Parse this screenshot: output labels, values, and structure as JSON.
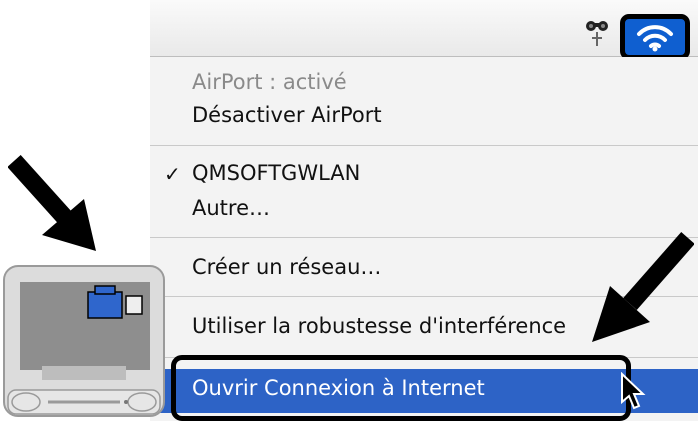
{
  "menubar": {
    "icons": [
      "binoculars-icon",
      "airport-wifi-icon"
    ]
  },
  "menu": {
    "status": "AirPort : activé",
    "turn_off": "Désactiver AirPort",
    "network_checked": "QMSOFTGWLAN",
    "other": "Autre…",
    "create_network": "Créer un réseau…",
    "interference": "Utiliser la robustesse d'interférence",
    "open_internet_connect": "Ouvrir Connexion à Internet",
    "checkmark": "✓"
  },
  "colors": {
    "highlight": "#2d63c6",
    "wifi_bg": "#0f5fd0",
    "menu_bg": "#f3f3f3"
  }
}
